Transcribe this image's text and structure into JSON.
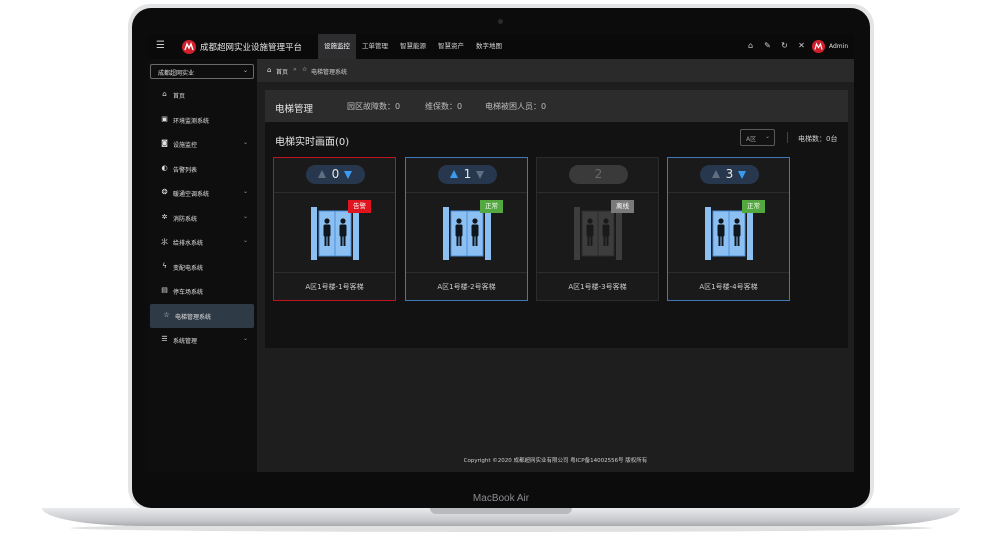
{
  "device": {
    "label": "MacBook Air"
  },
  "header": {
    "brand": "成都超网实业设施管理平台",
    "tabs": [
      {
        "label": "设施监控",
        "active": true
      },
      {
        "label": "工单管理",
        "active": false
      },
      {
        "label": "智慧能源",
        "active": false
      },
      {
        "label": "智慧资产",
        "active": false
      },
      {
        "label": "数字地图",
        "active": false
      }
    ],
    "user": "Admin",
    "icons": [
      "home-icon",
      "edit-icon",
      "refresh-icon",
      "fullscreen-icon"
    ],
    "accent_color": "#d11f2c"
  },
  "sidebar": {
    "org_select": "成都超网实业",
    "items": [
      {
        "label": "首页",
        "icon": "home-icon"
      },
      {
        "label": "环境监测系统",
        "icon": "monitor-icon"
      },
      {
        "label": "设施监控",
        "icon": "camera-icon",
        "expandable": true
      },
      {
        "label": "告警列表",
        "icon": "alarm-icon"
      },
      {
        "label": "暖通空调系统",
        "icon": "hvac-icon",
        "expandable": true
      },
      {
        "label": "消防系统",
        "icon": "fire-icon",
        "expandable": true
      },
      {
        "label": "给排水系统",
        "icon": "water-icon",
        "expandable": true
      },
      {
        "label": "变配电系统",
        "icon": "power-icon"
      },
      {
        "label": "停车场系统",
        "icon": "parking-icon"
      },
      {
        "label": "电梯管理系统",
        "icon": "star-icon",
        "active": true
      },
      {
        "label": "系统管理",
        "icon": "settings-icon",
        "expandable": true
      }
    ]
  },
  "breadcrumb": {
    "home": "首页",
    "separator": "»",
    "current": "电梯管理系统"
  },
  "summary": {
    "title": "电梯管理",
    "stats": [
      "园区故障数：0",
      "维保数：0",
      "电梯被困人员：0"
    ]
  },
  "panel": {
    "title": "电梯实时画面(0)",
    "zone_select": "A区",
    "elevator_count": "电梯数：0台"
  },
  "elevators": [
    {
      "floor": "0",
      "status": "告警",
      "status_color": "#e0141e",
      "border": "alarm",
      "up_active": false,
      "down_active": true,
      "name": "A区1号楼-1号客梯"
    },
    {
      "floor": "1",
      "status": "正常",
      "status_color": "#53a93f",
      "border": "normal",
      "up_active": true,
      "down_active": false,
      "name": "A区1号楼-2号客梯"
    },
    {
      "floor": "2",
      "status": "离线",
      "status_color": "#7a7a7a",
      "border": "offline",
      "up_active": false,
      "down_active": false,
      "name": "A区1号楼-3号客梯"
    },
    {
      "floor": "3",
      "status": "正常",
      "status_color": "#53a93f",
      "border": "normal",
      "up_active": false,
      "down_active": true,
      "name": "A区1号楼-4号客梯"
    }
  ],
  "footer": {
    "copyright": "Copyright ©2020 成都超网实业有限公司 粤ICP备14002556号 版权所有"
  }
}
